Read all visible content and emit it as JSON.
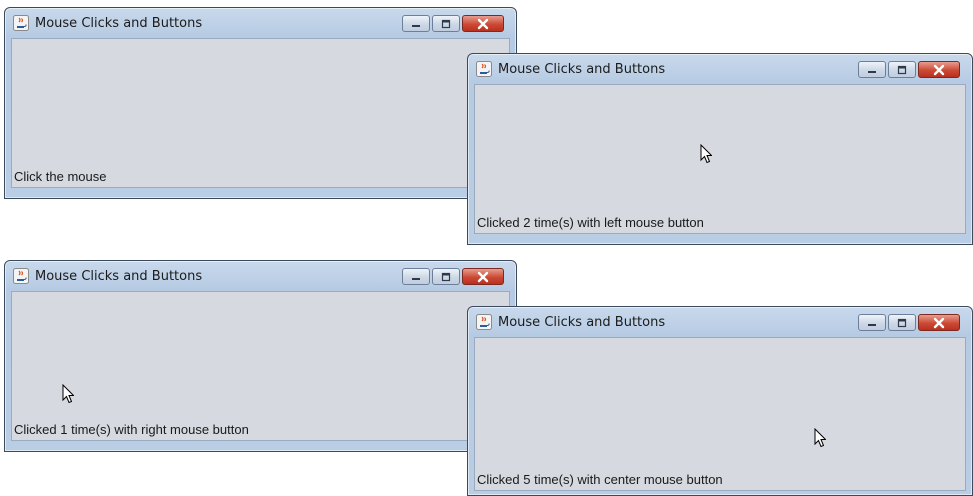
{
  "windows": [
    {
      "title": "Mouse Clicks and Buttons",
      "status": "Click the mouse",
      "controls": {
        "minimize": "minimize-icon",
        "maximize": "maximize-icon",
        "close": "close-icon"
      }
    },
    {
      "title": "Mouse Clicks and Buttons",
      "status": "Clicked 2 time(s) with left mouse button",
      "controls": {
        "minimize": "minimize-icon",
        "maximize": "maximize-icon",
        "close": "close-icon"
      }
    },
    {
      "title": "Mouse Clicks and Buttons",
      "status": "Clicked 1 time(s) with right mouse button",
      "controls": {
        "minimize": "minimize-icon",
        "maximize": "maximize-icon",
        "close": "close-icon"
      }
    },
    {
      "title": "Mouse Clicks and Buttons",
      "status": "Clicked 5 time(s) with center mouse button",
      "controls": {
        "minimize": "minimize-icon",
        "maximize": "maximize-icon",
        "close": "close-icon"
      }
    }
  ],
  "colors": {
    "client_background": "#d6d9df",
    "title_gradient_top": "#c9d9ec",
    "close_button": "#cc4a35"
  },
  "icons": {
    "app": "java-cup-icon",
    "cursor": "mouse-pointer-icon"
  }
}
